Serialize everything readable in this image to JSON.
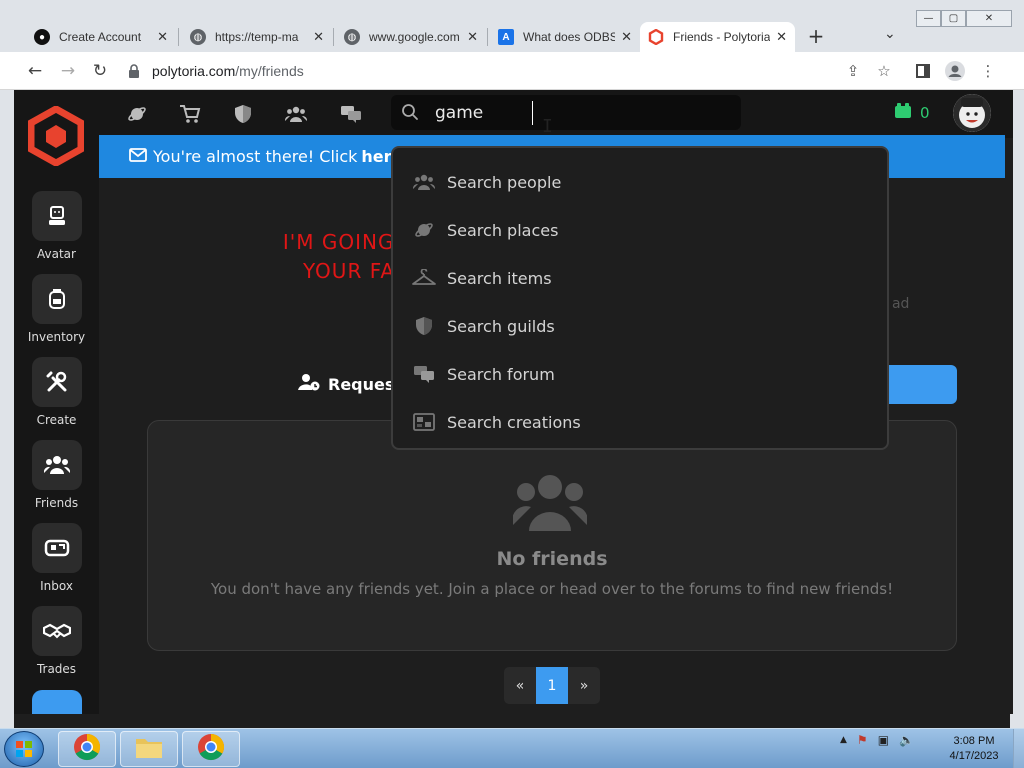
{
  "window": {
    "controls": [
      "minimize",
      "maximize",
      "close"
    ]
  },
  "tabs": [
    {
      "label": "Create Account",
      "favicon": "github-icon",
      "active": false
    },
    {
      "label": "https://temp-ma",
      "favicon": "globe-icon",
      "active": false
    },
    {
      "label": "www.google.com",
      "favicon": "globe-icon",
      "active": false
    },
    {
      "label": "What does ODBS",
      "favicon": "a-icon",
      "active": false
    },
    {
      "label": "Friends - Polytoria",
      "favicon": "polytoria-icon",
      "active": true
    }
  ],
  "address_bar": {
    "host": "polytoria.com",
    "path": "/my/friends"
  },
  "search": {
    "value": "game",
    "placeholder": ""
  },
  "currency": {
    "count": "0",
    "color": "#2ecc71"
  },
  "banner": {
    "text": "You're almost there! Click",
    "link": "here"
  },
  "ad": {
    "line1": "I'M GOING T",
    "line2": "YOUR FA",
    "side_text": "t ad"
  },
  "requests_label": "Request",
  "sidebar": {
    "items": [
      {
        "label": "Avatar",
        "icon": "avatar-icon"
      },
      {
        "label": "Inventory",
        "icon": "backpack-icon"
      },
      {
        "label": "Create",
        "icon": "tools-icon"
      },
      {
        "label": "Friends",
        "icon": "friends-icon"
      },
      {
        "label": "Inbox",
        "icon": "inbox-icon"
      },
      {
        "label": "Trades",
        "icon": "handshake-icon"
      }
    ]
  },
  "dropdown": {
    "items": [
      {
        "label": "Search people",
        "icon": "people-icon"
      },
      {
        "label": "Search places",
        "icon": "planet-icon"
      },
      {
        "label": "Search items",
        "icon": "hanger-icon"
      },
      {
        "label": "Search guilds",
        "icon": "shield-icon"
      },
      {
        "label": "Search forum",
        "icon": "chat-icon"
      },
      {
        "label": "Search creations",
        "icon": "creations-icon"
      }
    ]
  },
  "empty_state": {
    "title": "No friends",
    "body": "You don't have any friends yet. Join a place or head over to the forums to find new friends!"
  },
  "pagination": {
    "prev": "«",
    "current": "1",
    "next": "»"
  },
  "taskbar": {
    "time": "3:08 PM",
    "date": "4/17/2023"
  },
  "colors": {
    "accent": "#3d9bf0",
    "brand": "#e8432e",
    "ad_red": "#e01616"
  }
}
